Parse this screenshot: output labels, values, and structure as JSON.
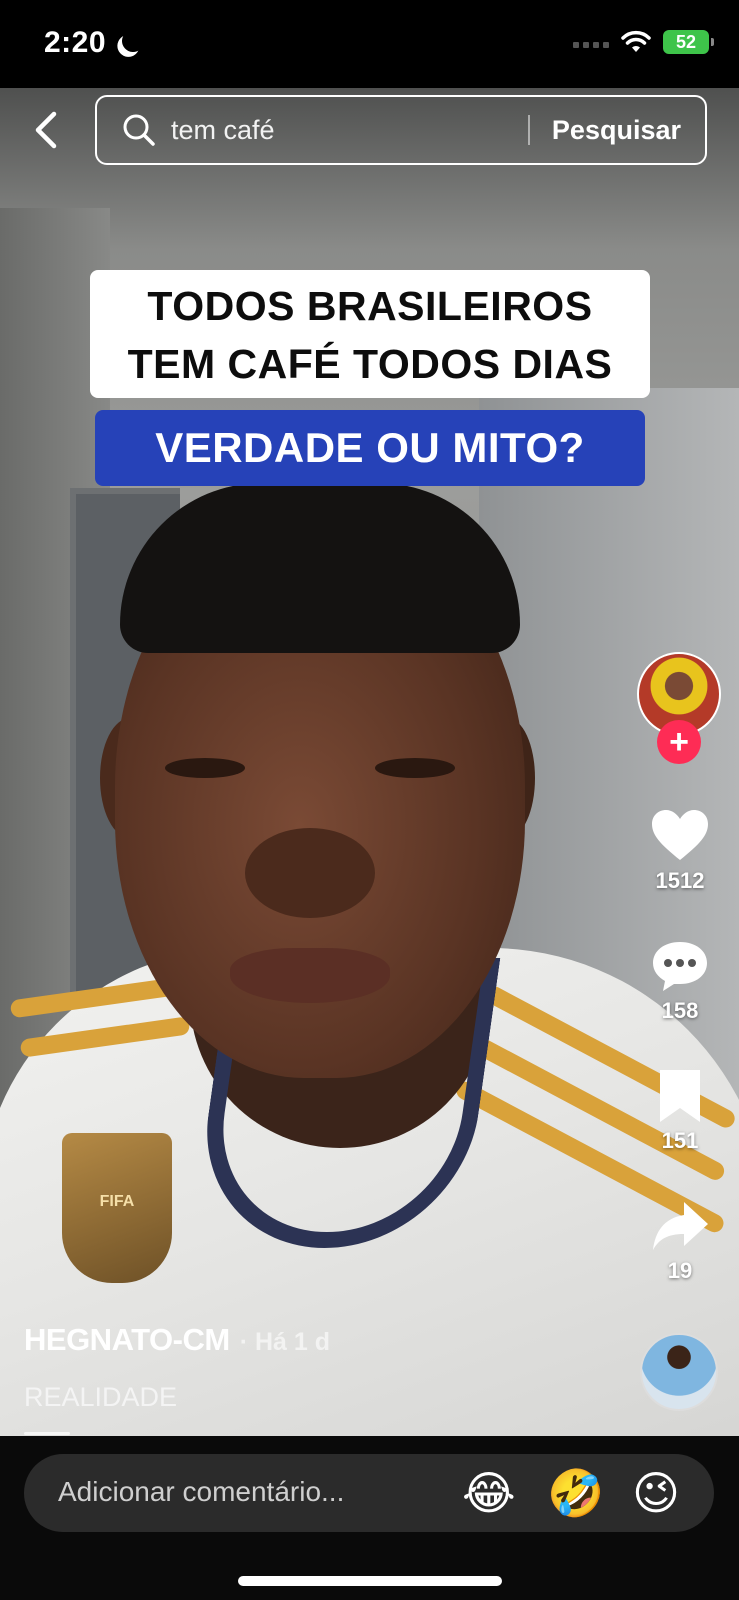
{
  "status_bar": {
    "time": "2:20",
    "battery": "52"
  },
  "search": {
    "query": "tem café",
    "button_label": "Pesquisar"
  },
  "caption": {
    "line1": "TODOS BRASILEIROS",
    "line2": "TEM CAFÉ TODOS DIAS",
    "highlight": "VERDADE OU MITO?"
  },
  "actions": {
    "likes": "1512",
    "comments": "158",
    "saves": "151",
    "shares": "19"
  },
  "post": {
    "creator": "HEGNATO-CM",
    "time_ago": "· Há 1 d",
    "description": "REALIDADE",
    "badge_text": "FIFA"
  },
  "comment_bar": {
    "placeholder": "Adicionar comentário...",
    "emojis": [
      "😂",
      "🤣",
      "😉"
    ]
  },
  "icons": {
    "back": "back-chevron-icon",
    "search": "search-icon",
    "like": "heart-icon",
    "comment": "comment-bubble-icon",
    "save": "bookmark-icon",
    "share": "share-arrow-icon"
  },
  "colors": {
    "follow_accent": "#fe2c55",
    "caption_blue": "#2642b8",
    "battery_green": "#3ec44a"
  }
}
